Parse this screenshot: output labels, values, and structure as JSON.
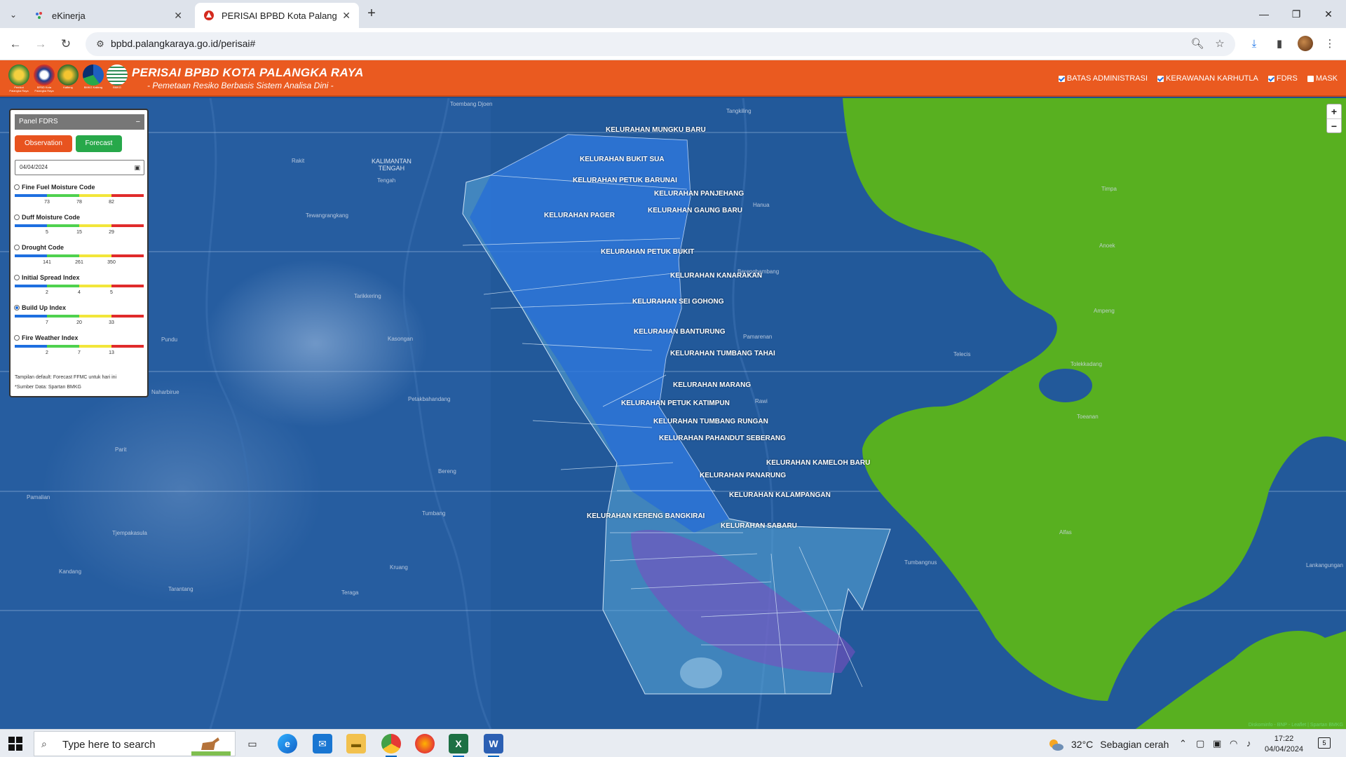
{
  "browser": {
    "tabs": [
      {
        "title": "eKinerja",
        "active": false
      },
      {
        "title": "PERISAI BPBD Kota Palangka Ra",
        "active": true
      }
    ],
    "url": "bpbd.palangkaraya.go.id/perisai#"
  },
  "header": {
    "title": "PERISAI BPBD KOTA PALANGKA RAYA",
    "subtitle": "- Pemetaan Resiko Berbasis Sistem Analisa Dini -",
    "logo_captions": [
      "Pemkot Palangka Raya",
      "BPBD Kota Palangka Raya",
      "Kalteng",
      "BMKG Kalteng",
      "BMKG"
    ],
    "layers": [
      {
        "label": "BATAS ADMINISTRASI",
        "checked": true
      },
      {
        "label": "KERAWANAN KARHUTLA",
        "checked": true
      },
      {
        "label": "FDRS",
        "checked": true
      },
      {
        "label": "MASK",
        "checked": false
      }
    ]
  },
  "panel": {
    "title": "Panel FDRS",
    "collapse": "−",
    "observation_label": "Observation",
    "forecast_label": "Forecast",
    "date": "04/04/2024",
    "indices": [
      {
        "name": "Fine Fuel Moisture Code",
        "ticks": [
          "73",
          "78",
          "82"
        ],
        "selected": false
      },
      {
        "name": "Duff Moisture Code",
        "ticks": [
          "5",
          "15",
          "29"
        ],
        "selected": false
      },
      {
        "name": "Drought Code",
        "ticks": [
          "141",
          "261",
          "350"
        ],
        "selected": false
      },
      {
        "name": "Initial Spread Index",
        "ticks": [
          "2",
          "4",
          "5"
        ],
        "selected": false
      },
      {
        "name": "Build Up Index",
        "ticks": [
          "7",
          "20",
          "33"
        ],
        "selected": true
      },
      {
        "name": "Fire Weather Index",
        "ticks": [
          "2",
          "7",
          "13"
        ],
        "selected": false
      }
    ],
    "scale_colors": [
      "#1e6fe0",
      "#4fd14f",
      "#f2e63a",
      "#e02b2b"
    ],
    "note": "Tampilan default: Forecast FFMC untuk hari ini",
    "source": "*Sumber Data: Spartan BMKG"
  },
  "map": {
    "kelurahan": [
      "KELURAHAN MUNGKU BARU",
      "KELURAHAN BUKIT SUA",
      "KELURAHAN PETUK BARUNAI",
      "KELURAHAN PANJEHANG",
      "KELURAHAN GAUNG BARU",
      "KELURAHAN PAGER",
      "KELURAHAN PETUK BUKIT",
      "KELURAHAN KANARAKAN",
      "KELURAHAN SEI GOHONG",
      "KELURAHAN BANTURUNG",
      "KELURAHAN TUMBANG TAHAI",
      "KELURAHAN MARANG",
      "KELURAHAN PETUK KATIMPUN",
      "KELURAHAN TUMBANG RUNGAN",
      "KELURAHAN PAHANDUT SEBERANG",
      "KELURAHAN KAMELOH BARU",
      "KELURAHAN PANARUNG",
      "KELURAHAN KALAMPANGAN",
      "KELURAHAN KERENG BANGKIRAI",
      "KELURAHAN SABARU"
    ],
    "places": [
      "Toembang Djoen",
      "Rakit",
      "Tewangrangkang",
      "Tangkiling",
      "Hanua",
      "Berengbambang",
      "Timpa",
      "Anoek",
      "Ampeng",
      "Tarikkering",
      "Pundu",
      "Kasongan",
      "Pamarenan",
      "Telecis",
      "Tolekkadang",
      "Naharbirue",
      "Petakbahandang",
      "Rawi",
      "Toeanan",
      "Parit",
      "Bereng",
      "Pamalian",
      "Tumbang",
      "Tjempakasula",
      "Kandang",
      "Kruang",
      "Tumbangnus",
      "Teraga",
      "Tarantang",
      "Alfas",
      "Lankangungan",
      "Tengah"
    ],
    "province_label": "KALIMANTAN\nTENGAH",
    "zoom_in": "+",
    "zoom_out": "−",
    "attribution": "Diskominfo - BNP - Leaflet | Spartan BMKG"
  },
  "taskbar": {
    "search_placeholder": "Type here to search",
    "weather_temp": "32°C",
    "weather_desc": "Sebagian cerah",
    "time": "17:22",
    "date": "04/04/2024",
    "notification_count": "5"
  }
}
